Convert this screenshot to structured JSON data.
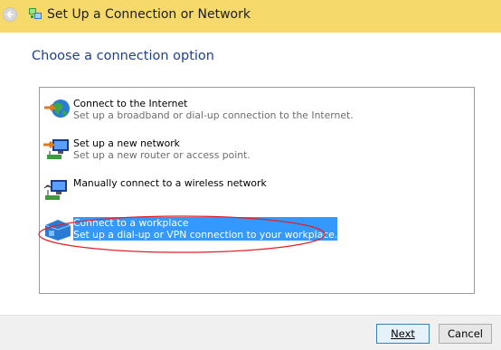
{
  "window": {
    "title": "Set Up a Connection or Network"
  },
  "main": {
    "heading": "Choose a connection option"
  },
  "options": [
    {
      "title": "Connect to the Internet",
      "description": "Set up a broadband or dial-up connection to the Internet.",
      "icon": "globe-icon",
      "selected": false
    },
    {
      "title": "Set up a new network",
      "description": "Set up a new router or access point.",
      "icon": "new-network-icon",
      "selected": false
    },
    {
      "title": "Manually connect to a wireless network",
      "description": "",
      "icon": "wireless-network-icon",
      "selected": false
    },
    {
      "title": "Connect to a workplace",
      "description": "Set up a dial-up or VPN connection to your workplace.",
      "icon": "workplace-icon",
      "selected": true
    }
  ],
  "buttons": {
    "next": "Next",
    "cancel": "Cancel"
  },
  "colors": {
    "titlebar": "#f6d96b",
    "heading": "#1f3f8f",
    "selection": "#3399ff",
    "annotation": "#e0202a"
  }
}
